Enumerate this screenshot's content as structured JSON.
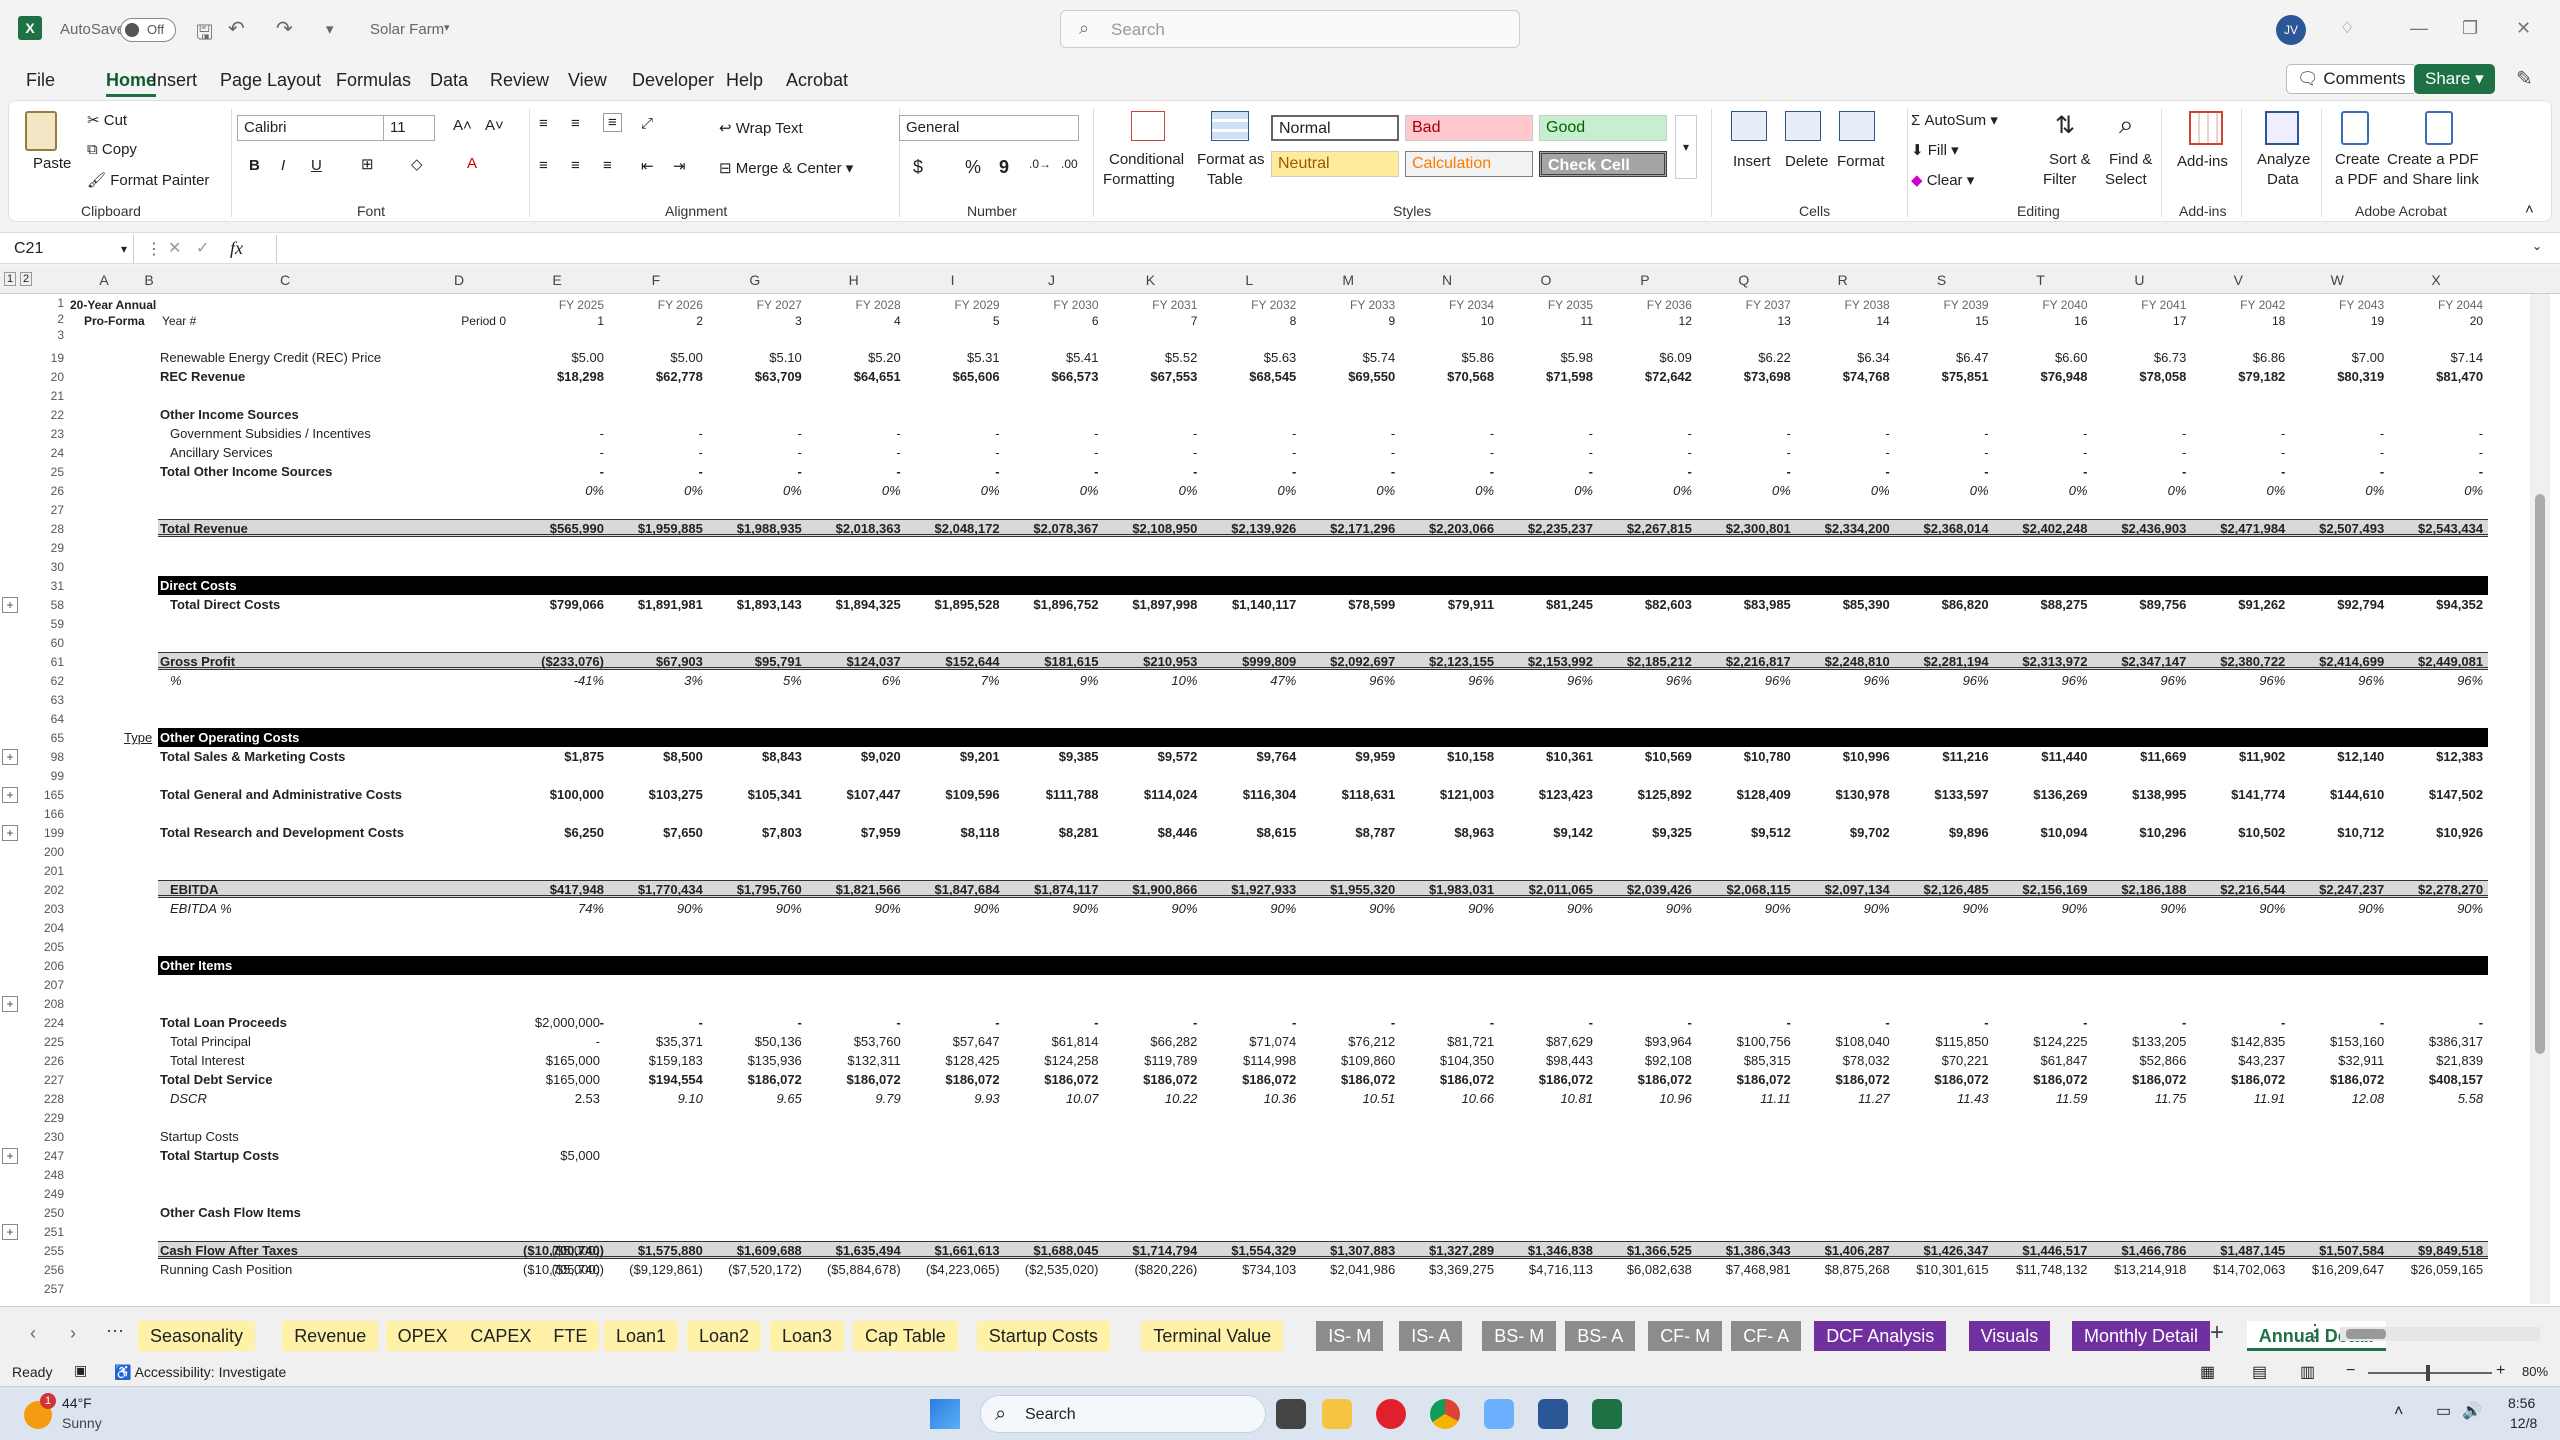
{
  "titlebar": {
    "autosave": "AutoSave",
    "autosave_state": "Off",
    "filename": "Solar Farm",
    "search_placeholder": "Search",
    "user_initials": "JV"
  },
  "menu": [
    "File",
    "Home",
    "Insert",
    "Page Layout",
    "Formulas",
    "Data",
    "Review",
    "View",
    "Developer",
    "Help",
    "Acrobat"
  ],
  "menu_active": "Home",
  "top_buttons": {
    "comments": "Comments",
    "share": "Share"
  },
  "ribbon": {
    "clipboard": {
      "paste": "Paste",
      "cut": "Cut",
      "copy": "Copy",
      "format_painter": "Format Painter",
      "label": "Clipboard"
    },
    "font": {
      "name": "Calibri",
      "size": "11",
      "label": "Font",
      "bold": "B",
      "italic": "I",
      "underline": "U"
    },
    "alignment": {
      "wrap": "Wrap Text",
      "merge": "Merge & Center",
      "label": "Alignment"
    },
    "number": {
      "format": "General",
      "label": "Number",
      "currency": "$",
      "percent": "%",
      "comma": "9"
    },
    "styles": {
      "conditional": "Conditional",
      "conditional2": "Formatting",
      "format_table": "Format as",
      "format_table2": "Table",
      "normal": "Normal",
      "bad": "Bad",
      "good": "Good",
      "neutral": "Neutral",
      "calculation": "Calculation",
      "check_cell": "Check Cell",
      "label": "Styles"
    },
    "cells": {
      "insert": "Insert",
      "delete": "Delete",
      "format": "Format",
      "label": "Cells"
    },
    "editing": {
      "autosum": "AutoSum",
      "fill": "Fill",
      "clear": "Clear",
      "sort": "Sort &",
      "sort2": "Filter",
      "find": "Find &",
      "find2": "Select",
      "label": "Editing"
    },
    "addins": {
      "addins": "Add-ins",
      "label": "Add-ins"
    },
    "analyze": {
      "a1": "Analyze",
      "a2": "Data"
    },
    "acrobat": {
      "create1": "Create",
      "create2": "a PDF",
      "share1": "Create a PDF",
      "share2": "and Share link",
      "label": "Adobe Acrobat"
    },
    "colors": {
      "bad_bg": "#ffc7ce",
      "bad_fg": "#9c0006",
      "good_bg": "#c6efce",
      "good_fg": "#006100",
      "neutral_bg": "#ffeb9c",
      "neutral_fg": "#9c5700",
      "calc_bg": "#f2f2f2",
      "calc_fg": "#fa7d00",
      "check_bg": "#a5a5a5"
    }
  },
  "formula_bar": {
    "cell_ref": "C21",
    "fx": "fx",
    "formula": ""
  },
  "columns": [
    "A",
    "B",
    "C",
    "D",
    "E",
    "F",
    "G",
    "H",
    "I",
    "J",
    "K",
    "L",
    "M",
    "N",
    "O",
    "P",
    "Q",
    "R",
    "S",
    "T",
    "U",
    "V",
    "W",
    "X"
  ],
  "header": {
    "title1": "20-Year Annual",
    "title2": "Pro-Forma",
    "year_label": "Year #",
    "period0": "Period 0",
    "fy": [
      "FY 2025",
      "FY 2026",
      "FY 2027",
      "FY 2028",
      "FY 2029",
      "FY 2030",
      "FY 2031",
      "FY 2032",
      "FY 2033",
      "FY 2034",
      "FY 2035",
      "FY 2036",
      "FY 2037",
      "FY 2038",
      "FY 2039",
      "FY 2040",
      "FY 2041",
      "FY 2042",
      "FY 2043",
      "FY 2044"
    ],
    "years": [
      "1",
      "2",
      "3",
      "4",
      "5",
      "6",
      "7",
      "8",
      "9",
      "10",
      "11",
      "12",
      "13",
      "14",
      "15",
      "16",
      "17",
      "18",
      "19",
      "20"
    ]
  },
  "rows": [
    {
      "n": "19",
      "label": "Renewable Energy Credit (REC) Price",
      "d": "",
      "v": [
        "$5.00",
        "$5.00",
        "$5.10",
        "$5.20",
        "$5.31",
        "$5.41",
        "$5.52",
        "$5.63",
        "$5.74",
        "$5.86",
        "$5.98",
        "$6.09",
        "$6.22",
        "$6.34",
        "$6.47",
        "$6.60",
        "$6.73",
        "$6.86",
        "$7.00",
        "$7.14"
      ]
    },
    {
      "n": "20",
      "label": "REC Revenue",
      "bold": true,
      "d": "",
      "v": [
        "$18,298",
        "$62,778",
        "$63,709",
        "$64,651",
        "$65,606",
        "$66,573",
        "$67,553",
        "$68,545",
        "$69,550",
        "$70,568",
        "$71,598",
        "$72,642",
        "$73,698",
        "$74,768",
        "$75,851",
        "$76,948",
        "$78,058",
        "$79,182",
        "$80,319",
        "$81,470"
      ]
    },
    {
      "n": "21",
      "label": "",
      "d": "",
      "v": []
    },
    {
      "n": "22",
      "label": "Other Income Sources",
      "bold": true,
      "d": "",
      "v": []
    },
    {
      "n": "23",
      "label": "Government Subsidies / Incentives",
      "indent": true,
      "d": "",
      "v": [
        "-",
        "-",
        "-",
        "-",
        "-",
        "-",
        "-",
        "-",
        "-",
        "-",
        "-",
        "-",
        "-",
        "-",
        "-",
        "-",
        "-",
        "-",
        "-",
        "-"
      ]
    },
    {
      "n": "24",
      "label": "Ancillary Services",
      "indent": true,
      "d": "",
      "v": [
        "-",
        "-",
        "-",
        "-",
        "-",
        "-",
        "-",
        "-",
        "-",
        "-",
        "-",
        "-",
        "-",
        "-",
        "-",
        "-",
        "-",
        "-",
        "-",
        "-"
      ]
    },
    {
      "n": "25",
      "label": "Total Other Income Sources",
      "bold": true,
      "d": "",
      "v": [
        "-",
        "-",
        "-",
        "-",
        "-",
        "-",
        "-",
        "-",
        "-",
        "-",
        "-",
        "-",
        "-",
        "-",
        "-",
        "-",
        "-",
        "-",
        "-",
        "-"
      ]
    },
    {
      "n": "26",
      "label": "",
      "italic": true,
      "d": "",
      "v": [
        "0%",
        "0%",
        "0%",
        "0%",
        "0%",
        "0%",
        "0%",
        "0%",
        "0%",
        "0%",
        "0%",
        "0%",
        "0%",
        "0%",
        "0%",
        "0%",
        "0%",
        "0%",
        "0%",
        "0%"
      ]
    },
    {
      "n": "27",
      "label": "",
      "d": "",
      "v": []
    },
    {
      "n": "28",
      "label": "Total Revenue",
      "bold": true,
      "gray": true,
      "d": "",
      "v": [
        "$565,990",
        "$1,959,885",
        "$1,988,935",
        "$2,018,363",
        "$2,048,172",
        "$2,078,367",
        "$2,108,950",
        "$2,139,926",
        "$2,171,296",
        "$2,203,066",
        "$2,235,237",
        "$2,267,815",
        "$2,300,801",
        "$2,334,200",
        "$2,368,014",
        "$2,402,248",
        "$2,436,903",
        "$2,471,984",
        "$2,507,493",
        "$2,543,434"
      ]
    },
    {
      "n": "29",
      "label": "",
      "d": "",
      "v": []
    },
    {
      "n": "30",
      "label": "",
      "d": "",
      "v": []
    },
    {
      "n": "31",
      "label": "Direct Costs",
      "band": true,
      "d": "",
      "v": []
    },
    {
      "n": "58",
      "label": "Total Direct Costs",
      "bold": true,
      "indent": true,
      "plus": true,
      "d": "",
      "v": [
        "$799,066",
        "$1,891,981",
        "$1,893,143",
        "$1,894,325",
        "$1,895,528",
        "$1,896,752",
        "$1,897,998",
        "$1,140,117",
        "$78,599",
        "$79,911",
        "$81,245",
        "$82,603",
        "$83,985",
        "$85,390",
        "$86,820",
        "$88,275",
        "$89,756",
        "$91,262",
        "$92,794",
        "$94,352"
      ]
    },
    {
      "n": "59",
      "label": "",
      "d": "",
      "v": []
    },
    {
      "n": "60",
      "label": "",
      "d": "",
      "v": []
    },
    {
      "n": "61",
      "label": "Gross Profit",
      "bold": true,
      "gray": true,
      "d": "",
      "v": [
        "($233,076)",
        "$67,903",
        "$95,791",
        "$124,037",
        "$152,644",
        "$181,615",
        "$210,953",
        "$999,809",
        "$2,092,697",
        "$2,123,155",
        "$2,153,992",
        "$2,185,212",
        "$2,216,817",
        "$2,248,810",
        "$2,281,194",
        "$2,313,972",
        "$2,347,147",
        "$2,380,722",
        "$2,414,699",
        "$2,449,081"
      ]
    },
    {
      "n": "62",
      "label": "%",
      "italic": true,
      "indent": true,
      "d": "",
      "v": [
        "-41%",
        "3%",
        "5%",
        "6%",
        "7%",
        "9%",
        "10%",
        "47%",
        "96%",
        "96%",
        "96%",
        "96%",
        "96%",
        "96%",
        "96%",
        "96%",
        "96%",
        "96%",
        "96%",
        "96%"
      ]
    },
    {
      "n": "63",
      "label": "",
      "d": "",
      "v": []
    },
    {
      "n": "64",
      "label": "",
      "d": "",
      "v": []
    },
    {
      "n": "65",
      "label": "Other Operating Costs",
      "band": true,
      "type": "Type",
      "d": "",
      "v": []
    },
    {
      "n": "98",
      "label": "Total Sales & Marketing Costs",
      "bold": true,
      "plus": true,
      "d": "",
      "v": [
        "$1,875",
        "$8,500",
        "$8,843",
        "$9,020",
        "$9,201",
        "$9,385",
        "$9,572",
        "$9,764",
        "$9,959",
        "$10,158",
        "$10,361",
        "$10,569",
        "$10,780",
        "$10,996",
        "$11,216",
        "$11,440",
        "$11,669",
        "$11,902",
        "$12,140",
        "$12,383"
      ]
    },
    {
      "n": "99",
      "label": "",
      "d": "",
      "v": []
    },
    {
      "n": "165",
      "label": "Total General and Administrative Costs",
      "bold": true,
      "plus": true,
      "d": "",
      "v": [
        "$100,000",
        "$103,275",
        "$105,341",
        "$107,447",
        "$109,596",
        "$111,788",
        "$114,024",
        "$116,304",
        "$118,631",
        "$121,003",
        "$123,423",
        "$125,892",
        "$128,409",
        "$130,978",
        "$133,597",
        "$136,269",
        "$138,995",
        "$141,774",
        "$144,610",
        "$147,502"
      ]
    },
    {
      "n": "166",
      "label": "",
      "d": "",
      "v": []
    },
    {
      "n": "199",
      "label": "Total Research and Development Costs",
      "bold": true,
      "plus": true,
      "d": "",
      "v": [
        "$6,250",
        "$7,650",
        "$7,803",
        "$7,959",
        "$8,118",
        "$8,281",
        "$8,446",
        "$8,615",
        "$8,787",
        "$8,963",
        "$9,142",
        "$9,325",
        "$9,512",
        "$9,702",
        "$9,896",
        "$10,094",
        "$10,296",
        "$10,502",
        "$10,712",
        "$10,926"
      ]
    },
    {
      "n": "200",
      "label": "",
      "d": "",
      "v": []
    },
    {
      "n": "201",
      "label": "",
      "d": "",
      "v": []
    },
    {
      "n": "202",
      "label": "EBITDA",
      "bold": true,
      "gray": true,
      "indent": true,
      "d": "",
      "v": [
        "$417,948",
        "$1,770,434",
        "$1,795,760",
        "$1,821,566",
        "$1,847,684",
        "$1,874,117",
        "$1,900,866",
        "$1,927,933",
        "$1,955,320",
        "$1,983,031",
        "$2,011,065",
        "$2,039,426",
        "$2,068,115",
        "$2,097,134",
        "$2,126,485",
        "$2,156,169",
        "$2,186,188",
        "$2,216,544",
        "$2,247,237",
        "$2,278,270"
      ]
    },
    {
      "n": "203",
      "label": "EBITDA %",
      "italic": true,
      "indent": true,
      "d": "",
      "v": [
        "74%",
        "90%",
        "90%",
        "90%",
        "90%",
        "90%",
        "90%",
        "90%",
        "90%",
        "90%",
        "90%",
        "90%",
        "90%",
        "90%",
        "90%",
        "90%",
        "90%",
        "90%",
        "90%",
        "90%"
      ]
    },
    {
      "n": "204",
      "label": "",
      "d": "",
      "v": []
    },
    {
      "n": "205",
      "label": "",
      "d": "",
      "v": []
    },
    {
      "n": "206",
      "label": "Other Items",
      "band": true,
      "d": "",
      "v": []
    },
    {
      "n": "207",
      "label": "",
      "d": "",
      "v": []
    },
    {
      "n": "208",
      "label": "",
      "plus": true,
      "d": "",
      "v": []
    },
    {
      "n": "224",
      "label": "Total Loan Proceeds",
      "bold": true,
      "d": "$2,000,000",
      "v": [
        "-",
        "-",
        "-",
        "-",
        "-",
        "-",
        "-",
        "-",
        "-",
        "-",
        "-",
        "-",
        "-",
        "-",
        "-",
        "-",
        "-",
        "-",
        "-",
        "-"
      ]
    },
    {
      "n": "225",
      "label": "Total Principal",
      "indent": true,
      "d": "-",
      "v": [
        "$35,371",
        "$50,136",
        "$53,760",
        "$57,647",
        "$61,814",
        "$66,282",
        "$71,074",
        "$76,212",
        "$81,721",
        "$87,629",
        "$93,964",
        "$100,756",
        "$108,040",
        "$115,850",
        "$124,225",
        "$133,205",
        "$142,835",
        "$153,160",
        "$386,317"
      ]
    },
    {
      "n": "226",
      "label": "Total Interest",
      "indent": true,
      "d": "$165,000",
      "v": [
        "$159,183",
        "$135,936",
        "$132,311",
        "$128,425",
        "$124,258",
        "$119,789",
        "$114,998",
        "$109,860",
        "$104,350",
        "$98,443",
        "$92,108",
        "$85,315",
        "$78,032",
        "$70,221",
        "$61,847",
        "$52,866",
        "$43,237",
        "$32,911",
        "$21,839"
      ]
    },
    {
      "n": "227",
      "label": "Total Debt Service",
      "bold": true,
      "d": "$165,000",
      "v": [
        "$194,554",
        "$186,072",
        "$186,072",
        "$186,072",
        "$186,072",
        "$186,072",
        "$186,072",
        "$186,072",
        "$186,072",
        "$186,072",
        "$186,072",
        "$186,072",
        "$186,072",
        "$186,072",
        "$186,072",
        "$186,072",
        "$186,072",
        "$186,072",
        "$408,157"
      ]
    },
    {
      "n": "228",
      "label": "DSCR",
      "italic": true,
      "indent": true,
      "d": "2.53",
      "v": [
        "9.10",
        "9.65",
        "9.79",
        "9.93",
        "10.07",
        "10.22",
        "10.36",
        "10.51",
        "10.66",
        "10.81",
        "10.96",
        "11.11",
        "11.27",
        "11.43",
        "11.59",
        "11.75",
        "11.91",
        "12.08",
        "5.58"
      ]
    },
    {
      "n": "229",
      "label": "",
      "d": "",
      "v": []
    },
    {
      "n": "230",
      "label": "Startup Costs",
      "d": "",
      "v": []
    },
    {
      "n": "247",
      "label": "Total Startup Costs",
      "bold": true,
      "plus": true,
      "d": "$5,000",
      "v": []
    },
    {
      "n": "248",
      "label": "",
      "d": "",
      "v": []
    },
    {
      "n": "249",
      "label": "",
      "d": "",
      "v": []
    },
    {
      "n": "250",
      "label": "Other Cash Flow Items",
      "bold": true,
      "d": "",
      "v": []
    },
    {
      "n": "251",
      "label": "",
      "plus": true,
      "d": "",
      "v": []
    },
    {
      "n": "255",
      "label": "Cash Flow After Taxes",
      "bold": true,
      "gray": true,
      "d": "($5,000)",
      "v": [
        "($10,700,740)",
        "$1,575,880",
        "$1,609,688",
        "$1,635,494",
        "$1,661,613",
        "$1,688,045",
        "$1,714,794",
        "$1,554,329",
        "$1,307,883",
        "$1,327,289",
        "$1,346,838",
        "$1,366,525",
        "$1,386,343",
        "$1,406,287",
        "$1,426,347",
        "$1,446,517",
        "$1,466,786",
        "$1,487,145",
        "$1,507,584",
        "$9,849,518"
      ]
    },
    {
      "n": "256",
      "label": "Running Cash Position",
      "d": "($5,000)",
      "v": [
        "($10,705,740)",
        "($9,129,861)",
        "($7,520,172)",
        "($5,884,678)",
        "($4,223,065)",
        "($2,535,020)",
        "($820,226)",
        "$734,103",
        "$2,041,986",
        "$3,369,275",
        "$4,716,113",
        "$6,082,638",
        "$7,468,981",
        "$8,875,268",
        "$10,301,615",
        "$11,748,132",
        "$13,214,918",
        "$14,702,063",
        "$16,209,647",
        "$26,059,165"
      ]
    },
    {
      "n": "257",
      "label": "",
      "d": "",
      "v": []
    }
  ],
  "sheet_tabs": [
    {
      "name": "Seasonality",
      "color": "#fff2a8"
    },
    {
      "name": "Revenue",
      "color": "#fff2a8"
    },
    {
      "name": "OPEX",
      "color": "#fff2a8"
    },
    {
      "name": "CAPEX",
      "color": "#fff2a8"
    },
    {
      "name": "FTE",
      "color": "#fff2a8"
    },
    {
      "name": "Loan1",
      "color": "#fff2a8"
    },
    {
      "name": "Loan2",
      "color": "#fff2a8"
    },
    {
      "name": "Loan3",
      "color": "#fff2a8"
    },
    {
      "name": "Cap Table",
      "color": "#fff2a8"
    },
    {
      "name": "Startup Costs",
      "color": "#fff2a8"
    },
    {
      "name": "Terminal Value",
      "color": "#fff2a8"
    },
    {
      "name": "IS- M",
      "color": "#8c8c8c"
    },
    {
      "name": "IS- A",
      "color": "#8c8c8c"
    },
    {
      "name": "BS- M",
      "color": "#8c8c8c"
    },
    {
      "name": "BS- A",
      "color": "#8c8c8c"
    },
    {
      "name": "CF- M",
      "color": "#8c8c8c"
    },
    {
      "name": "CF- A",
      "color": "#8c8c8c"
    },
    {
      "name": "DCF Analysis",
      "color": "#7030a0"
    },
    {
      "name": "Visuals",
      "color": "#7030a0"
    },
    {
      "name": "Monthly Detail",
      "color": "#7030a0"
    },
    {
      "name": "Annual Detail",
      "color": "#ffffff",
      "active": true
    }
  ],
  "status": {
    "ready": "Ready",
    "accessibility": "Accessibility: Investigate",
    "zoom": "80%"
  },
  "taskbar": {
    "temp": "44°F",
    "weather": "Sunny",
    "search": "Search",
    "time": "8:56",
    "date": "12/8",
    "badge": "1"
  }
}
